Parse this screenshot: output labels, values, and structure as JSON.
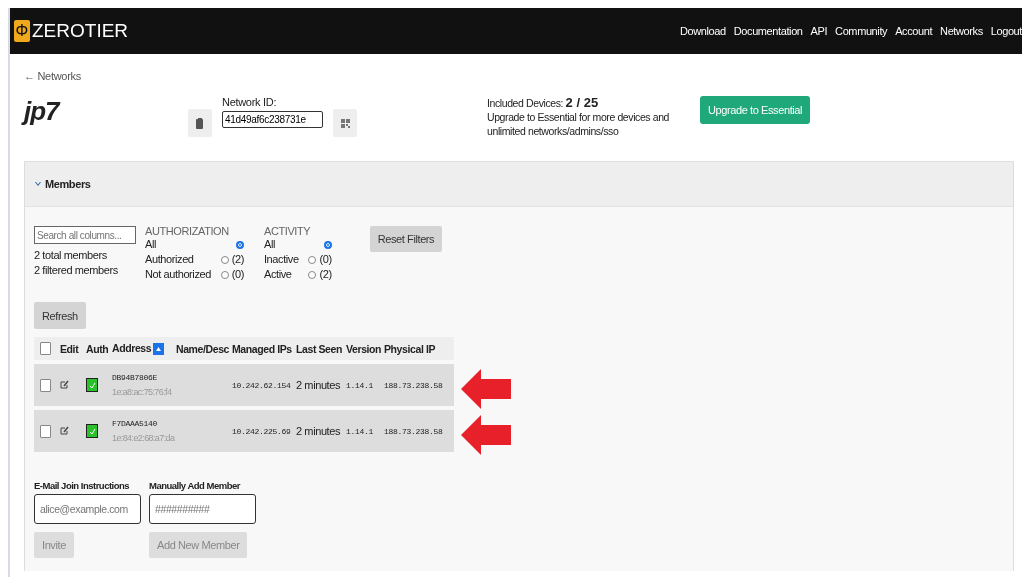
{
  "navbar": {
    "logo_mark": "Φ",
    "brand": "ZEROTIER",
    "links": [
      "Download",
      "Documentation",
      "API",
      "Community",
      "Account",
      "Networks",
      "Logout"
    ]
  },
  "back_link": "← Networks",
  "network": {
    "name": "jp7",
    "id_label": "Network ID:",
    "id_value": "41d49af6c238731e",
    "devices_label": "Included Devices:",
    "devices_count": "2 / 25",
    "upgrade_text": "Upgrade to Essential for more devices and unlimited networks/admins/sso",
    "upgrade_button": "Upgrade to Essential"
  },
  "members": {
    "title": "Members",
    "expanded": true,
    "search_placeholder": "Search all columns...",
    "total": "2 total members",
    "filtered": "2 filtered members",
    "filter_groups": [
      {
        "title": "AUTHORIZATION",
        "options": [
          {
            "label": "All",
            "selected": true
          },
          {
            "label": "Authorized",
            "count": "(2)",
            "selected": false
          },
          {
            "label": "Not authorized",
            "count": "(0)",
            "selected": false
          }
        ]
      },
      {
        "title": "ACTIVITY",
        "options": [
          {
            "label": "All",
            "selected": true
          },
          {
            "label": "Inactive",
            "count": "(0)",
            "selected": false
          },
          {
            "label": "Active",
            "count": "(2)",
            "selected": false
          }
        ]
      }
    ],
    "reset_button": "Reset Filters",
    "refresh_button": "Refresh",
    "select_all_checked": false,
    "columns": [
      "Edit",
      "Auth",
      "Address",
      "Name/Desc",
      "Managed IPs",
      "Last Seen",
      "Version",
      "Physical IP"
    ],
    "rows": [
      {
        "checked": false,
        "authorized": true,
        "address": "DB94B7806E",
        "mac": "1e:a8:ac:75:76:f4",
        "managed_ip": "10.242.62.154",
        "last_seen": "2 minutes",
        "version": "1.14.1",
        "physical_ip": "188.73.238.58",
        "pointed": true
      },
      {
        "checked": false,
        "authorized": true,
        "address": "F7DAAA5140",
        "mac": "1e:84:e2:68:a7:da",
        "managed_ip": "10.242.225.69",
        "last_seen": "2 minutes",
        "version": "1.14.1",
        "physical_ip": "188.73.238.58",
        "pointed": true
      }
    ],
    "invite_label": "E-Mail Join Instructions",
    "invite_placeholder": "alice@example.com",
    "invite_button": "Invite",
    "add_label": "Manually Add Member",
    "add_placeholder": "##########",
    "add_button": "Add New Member"
  }
}
